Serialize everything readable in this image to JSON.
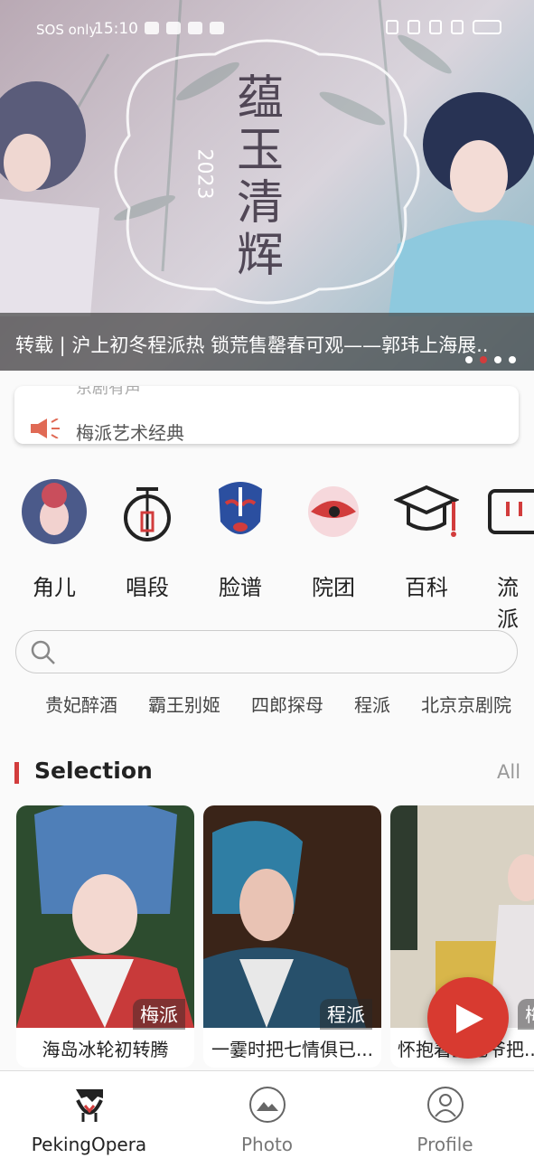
{
  "status_bar": {
    "carrier": "SOS only",
    "time": "15:10"
  },
  "banner": {
    "caption": "转载 | 沪上初冬程派热 锁荒售罄春可观——郭玮上海展..",
    "poster_title": "蕴玉清辉",
    "poster_year": "2023",
    "slides": 4,
    "active_slide": 2
  },
  "notice": {
    "previous": "京剧有声",
    "current": "梅派艺术经典"
  },
  "categories": [
    {
      "label": "角儿",
      "icon": "actor-portrait-icon"
    },
    {
      "label": "唱段",
      "icon": "pipa-instrument-icon"
    },
    {
      "label": "脸谱",
      "icon": "opera-mask-icon"
    },
    {
      "label": "院团",
      "icon": "troupe-eye-icon"
    },
    {
      "label": "百科",
      "icon": "graduation-cap-icon"
    },
    {
      "label": "流派",
      "icon": "scroll-icon"
    }
  ],
  "search": {
    "placeholder": ""
  },
  "hot_tags": [
    "贵妃醉酒",
    "霸王别姬",
    "四郎探母",
    "程派",
    "北京京剧院"
  ],
  "selection": {
    "title": "Selection",
    "all_label": "All",
    "cards": [
      {
        "title": "海岛冰轮初转腾",
        "school": "梅派"
      },
      {
        "title": "一霎时把七情俱已...",
        "school": "程派"
      },
      {
        "title": "怀抱着金冠爷把...",
        "school": "梅派"
      }
    ]
  },
  "bottom_nav": [
    {
      "label": "PekingOpera",
      "active": true
    },
    {
      "label": "Photo",
      "active": false
    },
    {
      "label": "Profile",
      "active": false
    }
  ],
  "colors": {
    "accent": "#d83a30",
    "text": "#222222",
    "muted": "#999999"
  }
}
